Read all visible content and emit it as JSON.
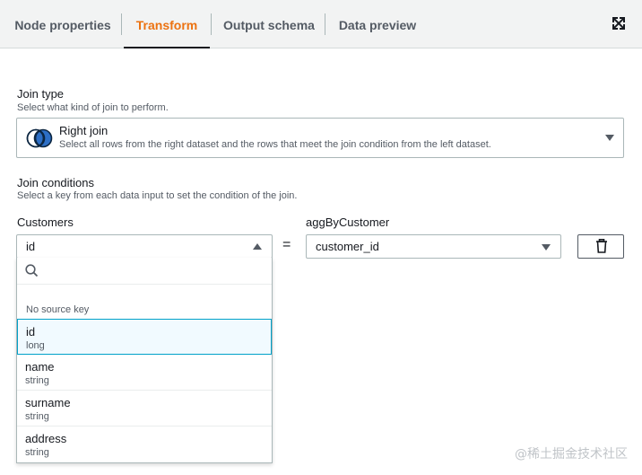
{
  "tabs": [
    {
      "label": "Node properties",
      "active": false
    },
    {
      "label": "Transform",
      "active": true
    },
    {
      "label": "Output schema",
      "active": false
    },
    {
      "label": "Data preview",
      "active": false
    }
  ],
  "icons": {
    "expand": "expand-icon",
    "venn": "right-join-venn-icon",
    "search": "search-icon",
    "delete": "trash-icon"
  },
  "colors": {
    "accent": "#ec7211",
    "selected_border": "#00a1c9",
    "selected_bg": "#f1faff"
  },
  "join_type": {
    "label": "Join type",
    "description": "Select what kind of join to perform.",
    "selected_title": "Right join",
    "selected_description": "Select all rows from the right dataset and the rows that meet the join condition from the left dataset."
  },
  "join_conditions": {
    "label": "Join conditions",
    "description": "Select a key from each data input to set the condition of the join.",
    "left_label": "Customers",
    "left_value": "id",
    "operator": "=",
    "right_label": "aggByCustomer",
    "right_value": "customer_id"
  },
  "dropdown": {
    "search_placeholder": "",
    "group_label": "No source key",
    "options": [
      {
        "name": "id",
        "type": "long",
        "selected": true
      },
      {
        "name": "name",
        "type": "string",
        "selected": false
      },
      {
        "name": "surname",
        "type": "string",
        "selected": false
      },
      {
        "name": "address",
        "type": "string",
        "selected": false
      }
    ]
  },
  "watermark": "@稀土掘金技术社区"
}
